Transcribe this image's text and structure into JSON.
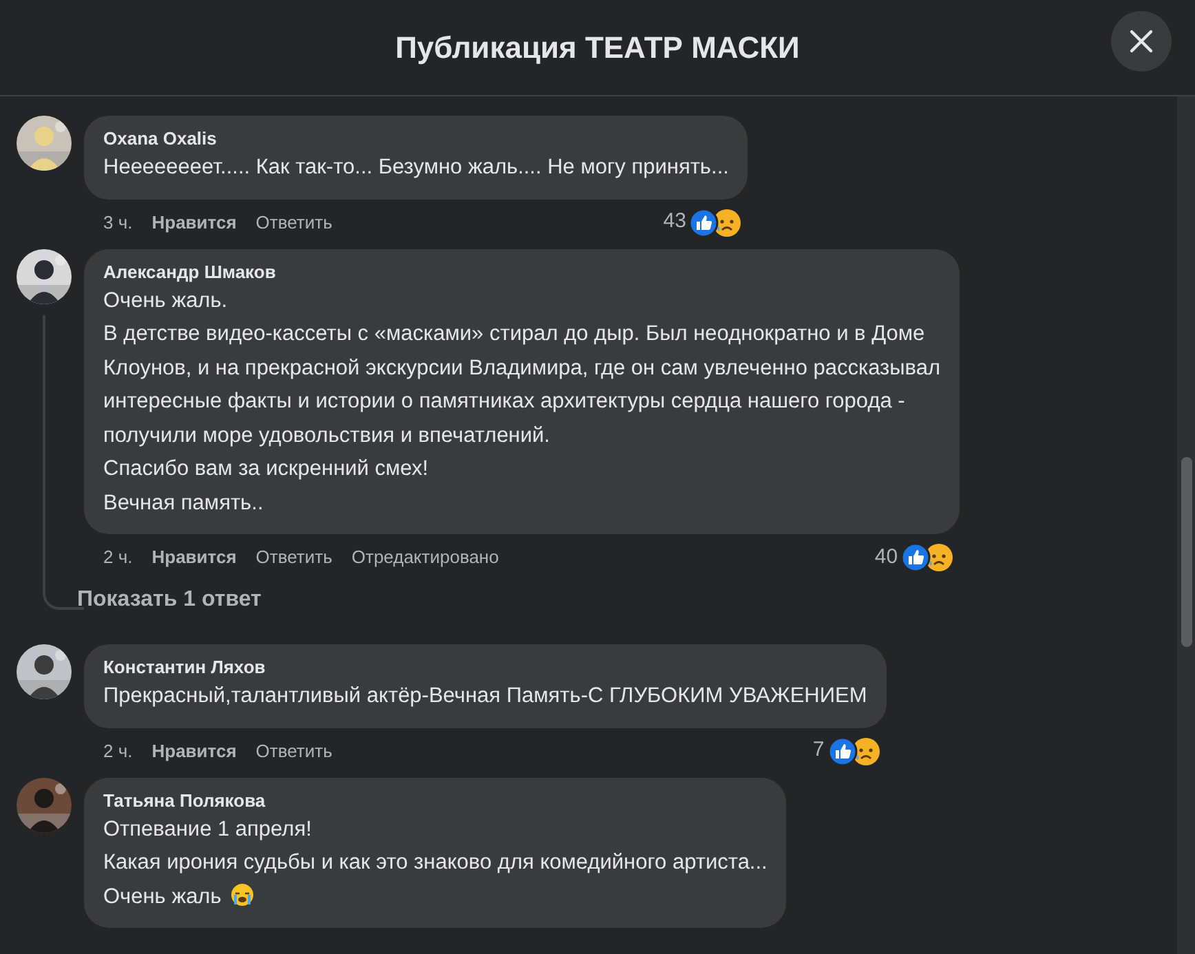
{
  "header": {
    "title": "Публикация ТЕАТР МАСКИ"
  },
  "comments": [
    {
      "author": "Oxana Oxalis",
      "lines": [
        {
          "text": "Неееееееет..... Как так-то... Безумно жаль.... Не могу принять..."
        }
      ],
      "time": "3 ч.",
      "like": "Нравится",
      "reply": "Ответить",
      "reactions": "43",
      "thread": false
    },
    {
      "author": "Александр Шмаков",
      "lines": [
        {
          "text": "Очень жаль."
        },
        {
          "text": "В детстве видео-кассеты с «масками» стирал до дыр. Был неоднократно и в Доме"
        },
        {
          "text": "Клоунов, и на прекрасной экскурсии Владимира, где он сам увлеченно рассказывал"
        },
        {
          "text": "интересные факты и истории о памятниках архитектуры сердца нашего города -"
        },
        {
          "text": "получили море удовольствия и впечатлений."
        },
        {
          "text": "Спасибо вам за искренний смех!"
        },
        {
          "text": "Вечная память.."
        }
      ],
      "time": "2 ч.",
      "like": "Нравится",
      "reply": "Ответить",
      "edited": "Отредактировано",
      "reactions": "40",
      "thread": true,
      "show_replies": "Показать 1 ответ"
    },
    {
      "author": "Константин Ляхов",
      "lines": [
        {
          "text": "Прекрасный,талантливый актёр-Вечная Память-С ГЛУБОКИМ УВАЖЕНИЕМ"
        }
      ],
      "time": "2 ч.",
      "like": "Нравится",
      "reply": "Ответить",
      "reactions": "7",
      "thread": false
    },
    {
      "author": "Татьяна Полякова",
      "lines": [
        {
          "text": "Отпевание 1 апреля!"
        },
        {
          "text": "Какая ирония судьбы и как это знаково для комедийного артиста..."
        },
        {
          "text": "Очень жаль",
          "emoji": true
        }
      ],
      "thread": false
    }
  ]
}
